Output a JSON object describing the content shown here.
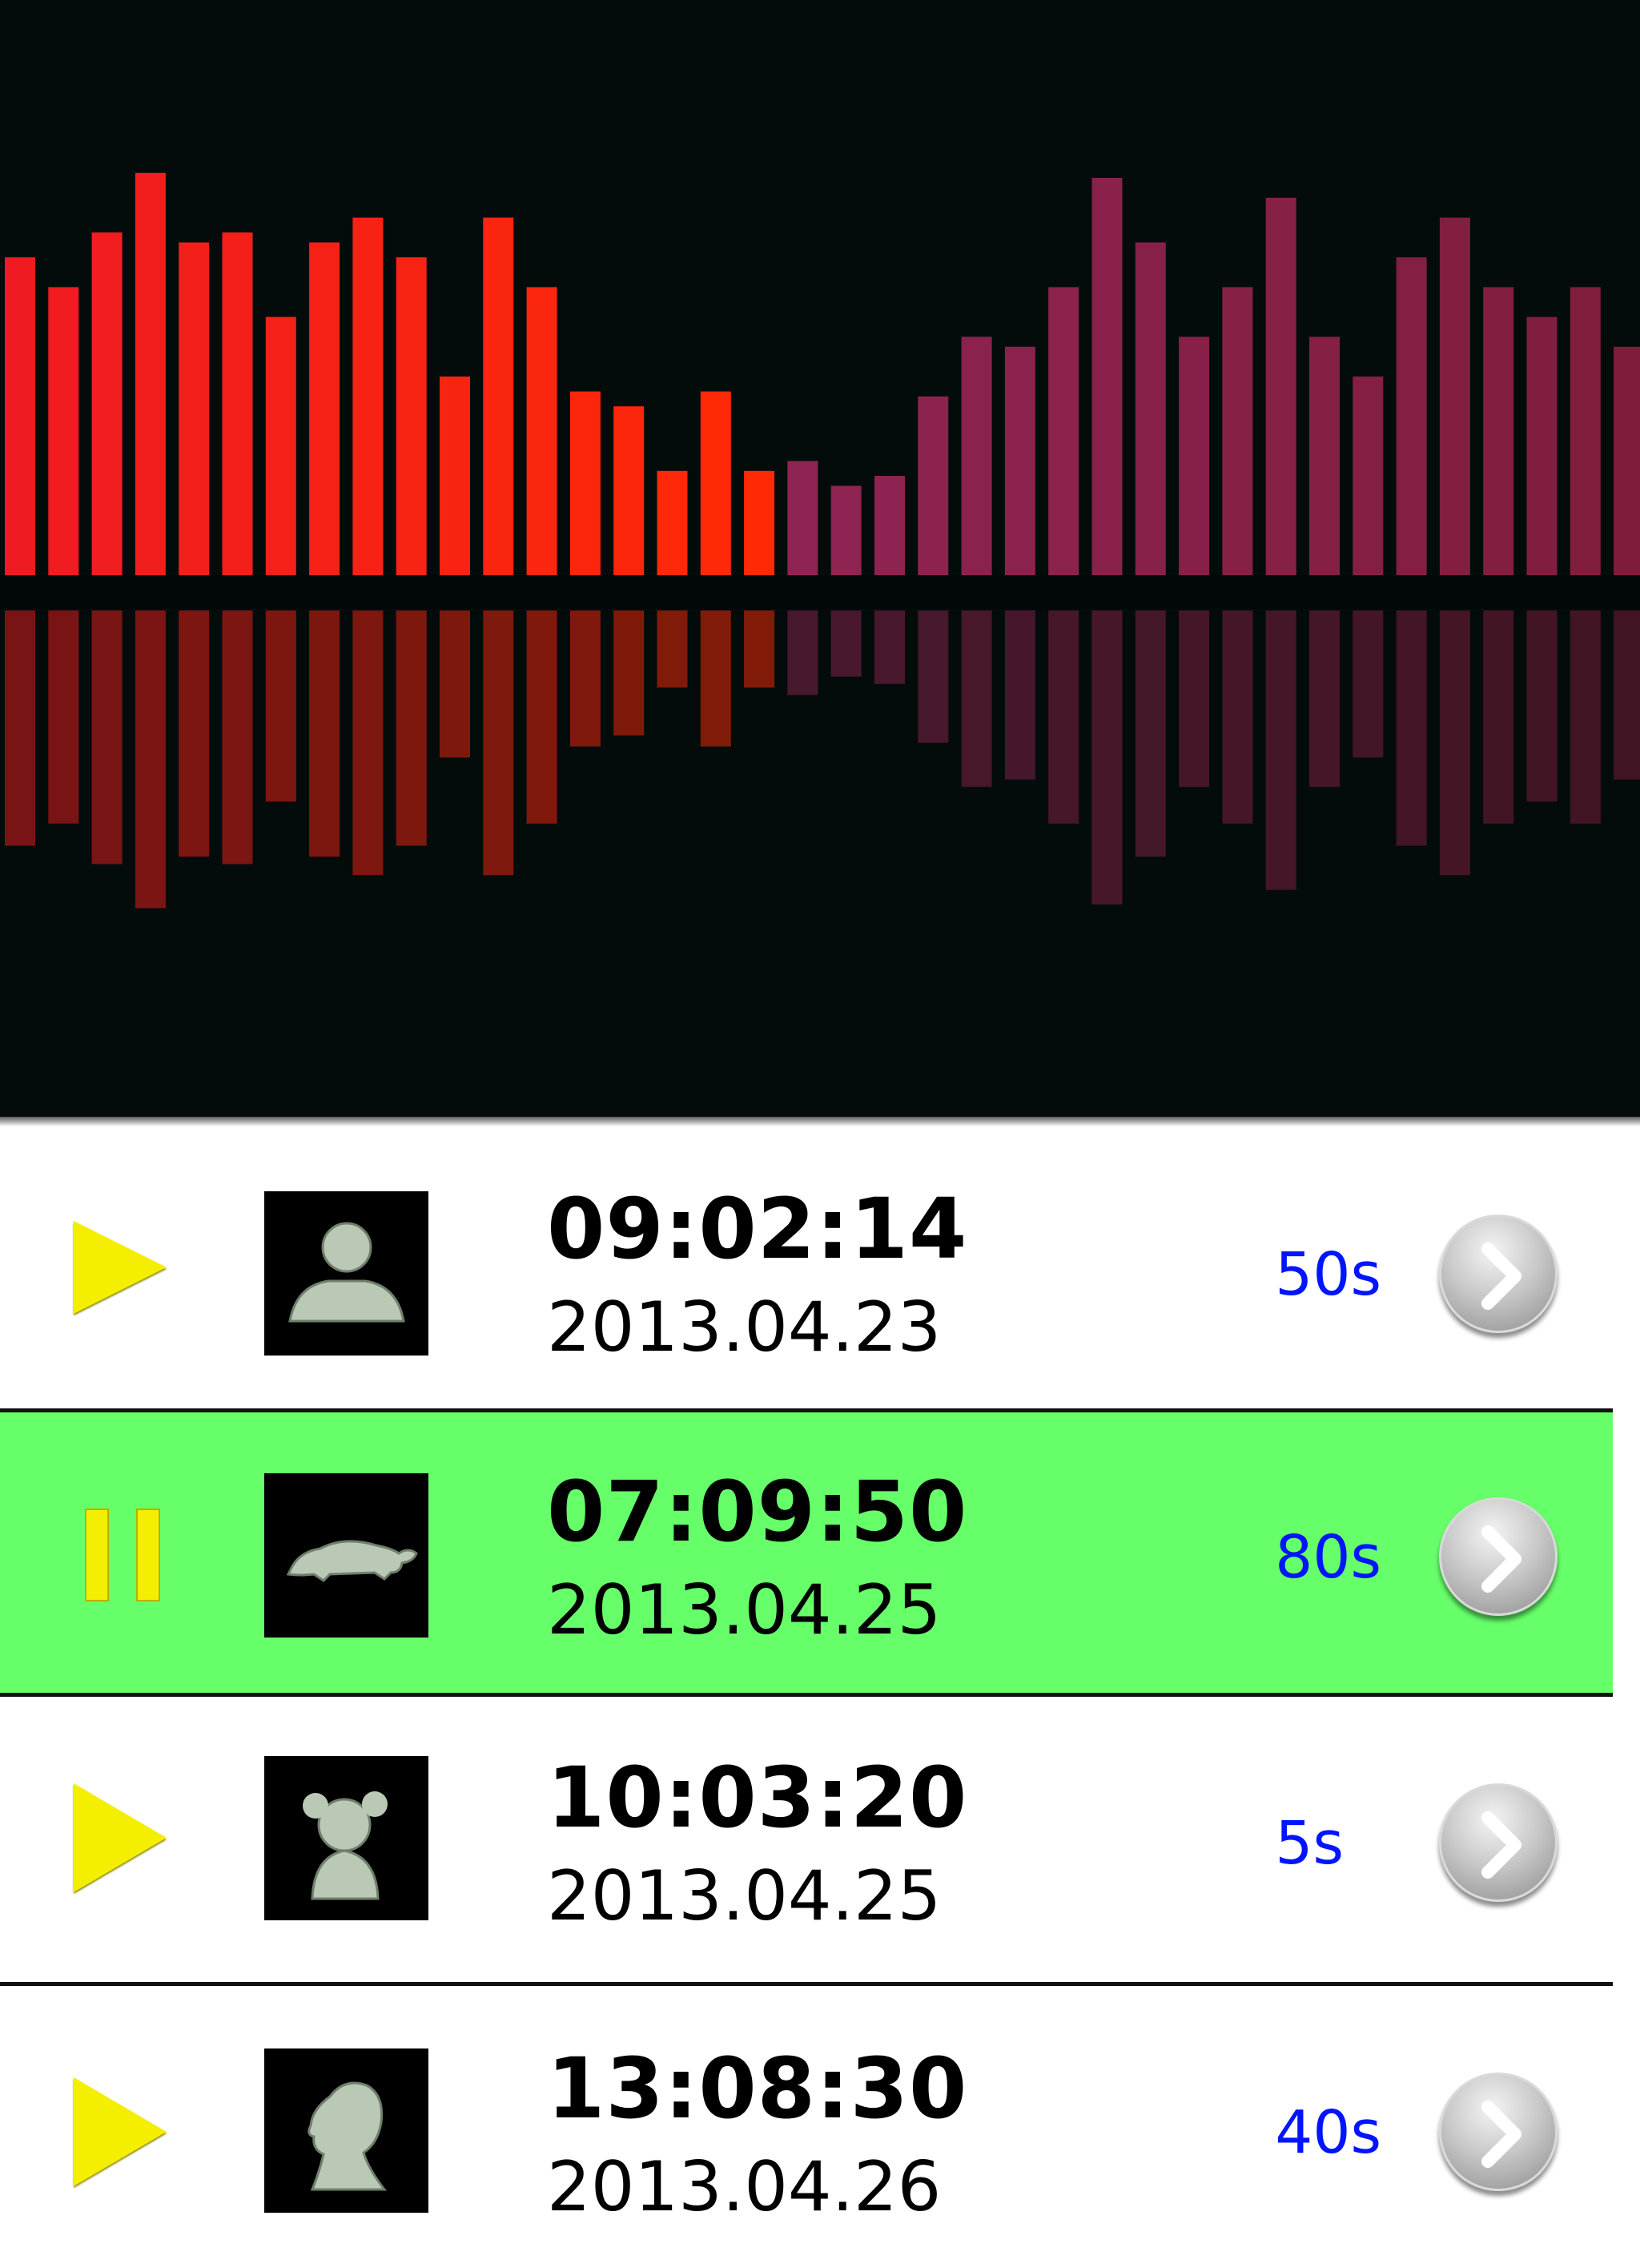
{
  "colors": {
    "background_top": "#030c0b",
    "active_row": "#66ff6a",
    "duration_text": "#0014ff",
    "play_icon": "#f4ee00",
    "bars_warm": [
      "#ef1b22",
      "#ff2a05"
    ],
    "bars_cool": [
      "#8e2453",
      "#7f1c3a"
    ]
  },
  "visualizer": {
    "levels": [
      0.64,
      0.58,
      0.69,
      0.81,
      0.67,
      0.69,
      0.52,
      0.67,
      0.72,
      0.64,
      0.4,
      0.72,
      0.58,
      0.37,
      0.34,
      0.21,
      0.37,
      0.21,
      0.23,
      0.18,
      0.2,
      0.36,
      0.48,
      0.46,
      0.58,
      0.8,
      0.67,
      0.48,
      0.58,
      0.76,
      0.48,
      0.4,
      0.64,
      0.72,
      0.58,
      0.52,
      0.58,
      0.46,
      0.36
    ],
    "reflection": true
  },
  "recordings": [
    {
      "state": "play-icon",
      "avatar": "person-silhouette-icon",
      "time": "09:02:14",
      "date": "2013.04.23",
      "duration": "50s",
      "active": false
    },
    {
      "state": "pause-icon",
      "avatar": "turtle-icon",
      "time": "07:09:50",
      "date": "2013.04.25",
      "duration": "80s",
      "active": true
    },
    {
      "state": "play-icon",
      "avatar": "girl-silhouette-icon",
      "time": "10:03:20",
      "date": "2013.04.25",
      "duration": "5s",
      "active": false
    },
    {
      "state": "play-icon",
      "avatar": "woman-silhouette-icon",
      "time": "13:08:30",
      "date": "2013.04.26",
      "duration": "40s",
      "active": false
    }
  ]
}
